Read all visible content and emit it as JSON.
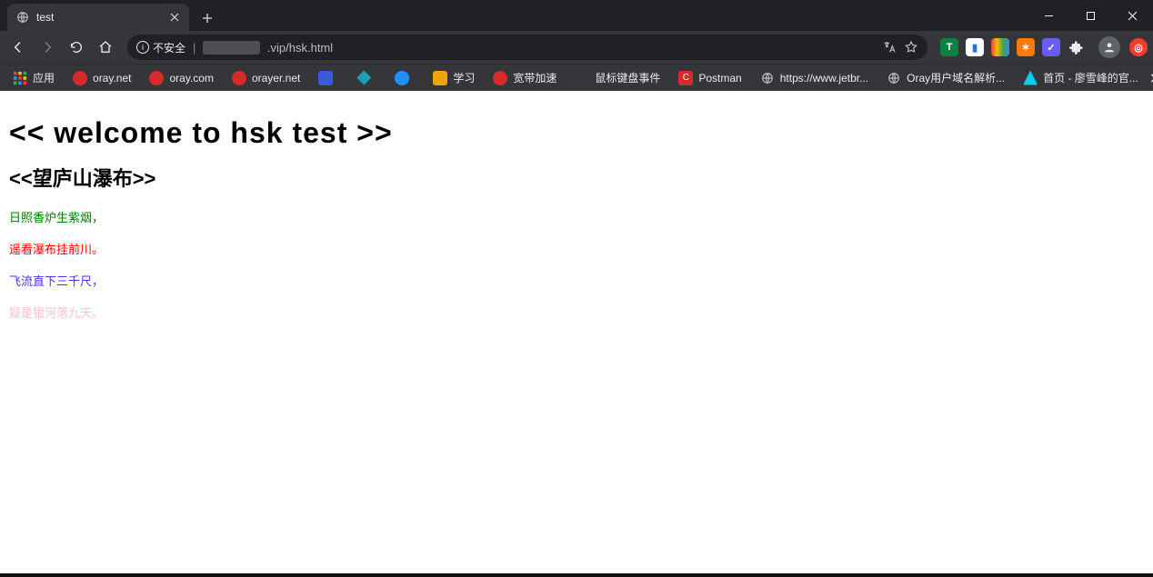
{
  "window": {
    "controls": {
      "min": "—",
      "max": "▢",
      "close": "✕"
    }
  },
  "tab": {
    "title": "test"
  },
  "toolbar": {
    "warn_label": "不安全",
    "url_blur": "xxxxxxxxx",
    "url_rest": ".vip/hsk.html"
  },
  "bookmarks": {
    "apps_label": "应用",
    "items": [
      {
        "label": "oray.net"
      },
      {
        "label": "oray.com"
      },
      {
        "label": "orayer.net"
      },
      {
        "label": ""
      },
      {
        "label": ""
      },
      {
        "label": ""
      },
      {
        "label": "学习"
      },
      {
        "label": "宽带加速"
      },
      {
        "label": "鼠标键盘事件"
      },
      {
        "label": "Postman"
      },
      {
        "label": "https://www.jetbr..."
      },
      {
        "label": "Oray用户域名解析..."
      },
      {
        "label": "首页 - 廖雪峰的官..."
      }
    ]
  },
  "page": {
    "h1": "<< welcome to hsk test >>",
    "h2": "<<望庐山瀑布>>",
    "lines": [
      "日照香炉生紫烟，",
      "遥看瀑布挂前川。",
      "飞流直下三千尺，",
      "疑是银河落九天。"
    ]
  }
}
